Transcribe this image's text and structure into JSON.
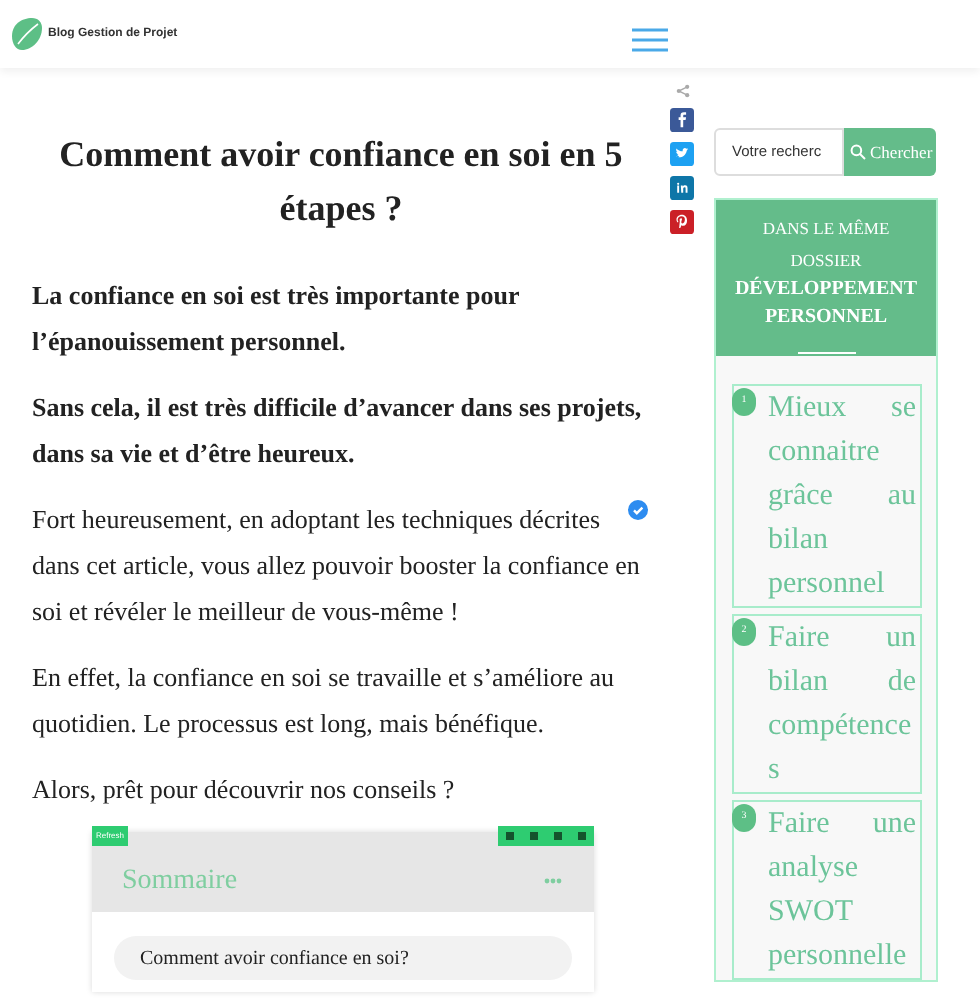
{
  "header": {
    "logo_text": "Blog Gestion de Projet"
  },
  "article": {
    "title": "Comment avoir confiance en soi en 5 étapes ?",
    "paragraphs": [
      {
        "text": "La confiance en soi est très importante pour l’épanouissement personnel.",
        "bold": true,
        "verified": false
      },
      {
        "text": "Sans cela, il est très difficile d’avancer dans ses projets, dans sa vie et d’être heureux.",
        "bold": true,
        "verified": false
      },
      {
        "text": "Fort heureusement, en adoptant les techniques décrites dans cet article, vous allez pouvoir booster la confiance en soi et révéler le meilleur de vous-même !",
        "bold": false,
        "verified": true
      },
      {
        "text": "En effet, la confiance en soi se travaille et s’améliore au quotidien. Le processus est long, mais bénéfique.",
        "bold": false,
        "verified": false
      },
      {
        "text": "Alors, prêt pour découvrir nos conseils ?",
        "bold": false,
        "verified": false
      }
    ],
    "share": [
      {
        "kind": "share"
      },
      {
        "kind": "facebook"
      },
      {
        "kind": "twitter"
      },
      {
        "kind": "linkedin"
      },
      {
        "kind": "pinterest"
      }
    ],
    "summary": {
      "refresh": "Refresh",
      "title": "Sommaire",
      "question": "Comment avoir confiance en soi?"
    }
  },
  "sidebar": {
    "search": {
      "placeholder": "Votre recherc",
      "button": "Chercher"
    },
    "dossier": {
      "kicker": "DANS LE MÊME DOSSIER",
      "title": "DÉVELOPPEMENT PERSONNEL",
      "items": [
        {
          "number": "1",
          "title": "Mieux se connaitre grâce au bilan personnel"
        },
        {
          "number": "2",
          "title": "Faire un bilan de compétences"
        },
        {
          "number": "3",
          "title": "Faire une analyse SWOT personnelle"
        }
      ]
    }
  }
}
